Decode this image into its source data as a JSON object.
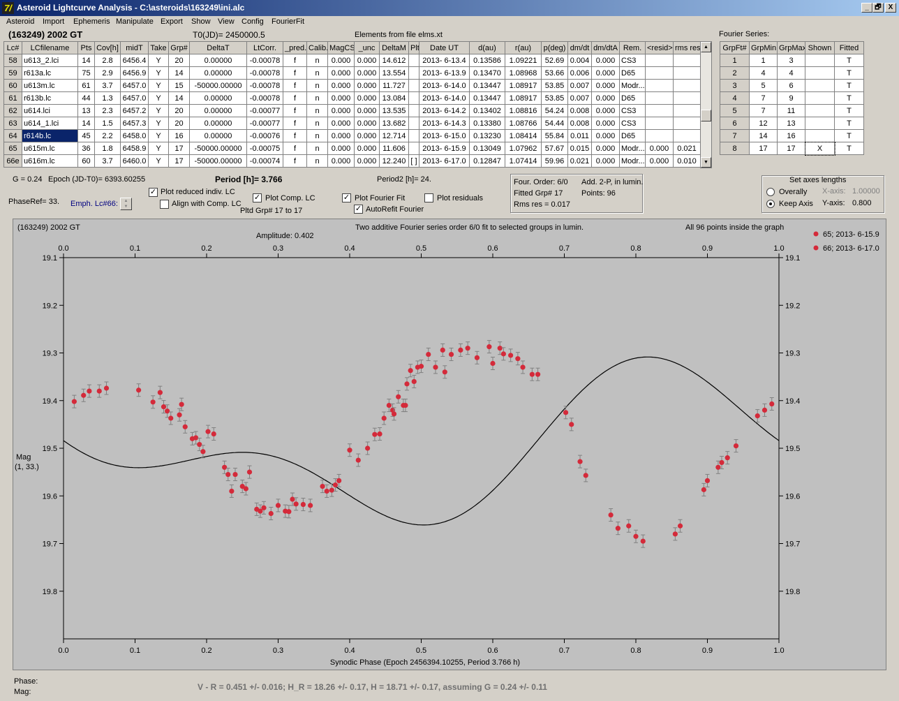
{
  "window": {
    "title": "Asteroid Lightcurve Analysis - C:\\asteroids\\163249\\ini.alc",
    "app_icon": "7/",
    "min": "_",
    "restore": "🗗",
    "close": "X"
  },
  "menu": [
    "Asteroid",
    "Import",
    "Ephemeris",
    "Manipulate",
    "Export",
    "Show",
    "View",
    "Config",
    "FourierFit"
  ],
  "header": {
    "object": "(163249) 2002 GT",
    "t0": "T0(JD)= 2450000.5",
    "elements": "Elements from file elms.xt",
    "fourier_label": "Fourier Series:"
  },
  "lc_table": {
    "columns": [
      "Lc#",
      "LCfilename",
      "Pts",
      "Cov[h]",
      "midT",
      "Take",
      "Grp#",
      "DeltaT",
      "LtCorr.",
      "_pred.",
      "Calib.",
      "MagCS",
      "_unc",
      "DeltaM",
      "Plt",
      "Date UT",
      "d(au)",
      "r(au)",
      "p(deg)",
      "dm/dt",
      "dm/dtA",
      "Rem.",
      "<resid>",
      "rms res"
    ],
    "rows": [
      [
        "58",
        "u613_2.lci",
        "14",
        "2.8",
        "6456.4",
        "Y",
        "20",
        "0.00000",
        "-0.00078",
        "f",
        "n",
        "0.000",
        "0.000",
        "14.612",
        "",
        "2013- 6-13.4",
        "0.13586",
        "1.09221",
        "52.69",
        "0.004",
        "0.000",
        "CS3",
        "",
        ""
      ],
      [
        "59",
        "r613a.lc",
        "75",
        "2.9",
        "6456.9",
        "Y",
        "14",
        "0.00000",
        "-0.00078",
        "f",
        "n",
        "0.000",
        "0.000",
        "13.554",
        "",
        "2013- 6-13.9",
        "0.13470",
        "1.08968",
        "53.66",
        "0.006",
        "0.000",
        "D65",
        "",
        ""
      ],
      [
        "60",
        "u613m.lc",
        "61",
        "3.7",
        "6457.0",
        "Y",
        "15",
        "-50000.00000",
        "-0.00078",
        "f",
        "n",
        "0.000",
        "0.000",
        "11.727",
        "",
        "2013- 6-14.0",
        "0.13447",
        "1.08917",
        "53.85",
        "0.007",
        "0.000",
        "Modr...",
        "",
        ""
      ],
      [
        "61",
        "r613b.lc",
        "44",
        "1.3",
        "6457.0",
        "Y",
        "14",
        "0.00000",
        "-0.00078",
        "f",
        "n",
        "0.000",
        "0.000",
        "13.084",
        "",
        "2013- 6-14.0",
        "0.13447",
        "1.08917",
        "53.85",
        "0.007",
        "0.000",
        "D65",
        "",
        ""
      ],
      [
        "62",
        "u614.lci",
        "13",
        "2.3",
        "6457.2",
        "Y",
        "20",
        "0.00000",
        "-0.00077",
        "f",
        "n",
        "0.000",
        "0.000",
        "13.535",
        "",
        "2013- 6-14.2",
        "0.13402",
        "1.08816",
        "54.24",
        "0.008",
        "0.000",
        "CS3",
        "",
        ""
      ],
      [
        "63",
        "u614_1.lci",
        "14",
        "1.5",
        "6457.3",
        "Y",
        "20",
        "0.00000",
        "-0.00077",
        "f",
        "n",
        "0.000",
        "0.000",
        "13.682",
        "",
        "2013- 6-14.3",
        "0.13380",
        "1.08766",
        "54.44",
        "0.008",
        "0.000",
        "CS3",
        "",
        ""
      ],
      [
        "64",
        "r614b.lc",
        "45",
        "2.2",
        "6458.0",
        "Y",
        "16",
        "0.00000",
        "-0.00076",
        "f",
        "n",
        "0.000",
        "0.000",
        "12.714",
        "",
        "2013- 6-15.0",
        "0.13230",
        "1.08414",
        "55.84",
        "0.011",
        "0.000",
        "D65",
        "",
        ""
      ],
      [
        "65",
        "u615m.lc",
        "36",
        "1.8",
        "6458.9",
        "Y",
        "17",
        "-50000.00000",
        "-0.00075",
        "f",
        "n",
        "0.000",
        "0.000",
        "11.606",
        "",
        "2013- 6-15.9",
        "0.13049",
        "1.07962",
        "57.67",
        "0.015",
        "0.000",
        "Modr...",
        "0.000",
        "0.021"
      ],
      [
        "66e",
        "u616m.lc",
        "60",
        "3.7",
        "6460.0",
        "Y",
        "17",
        "-50000.00000",
        "-0.00074",
        "f",
        "n",
        "0.000",
        "0.000",
        "12.240",
        "[ ]",
        "2013- 6-17.0",
        "0.12847",
        "1.07414",
        "59.96",
        "0.021",
        "0.000",
        "Modr...",
        "0.000",
        "0.010"
      ]
    ],
    "selected_row": 6
  },
  "fourier_table": {
    "columns": [
      "GrpFt#",
      "GrpMin",
      "GrpMax",
      "Shown",
      "Fitted"
    ],
    "rows": [
      [
        "1",
        "1",
        "3",
        "",
        "T"
      ],
      [
        "2",
        "4",
        "4",
        "",
        "T"
      ],
      [
        "3",
        "5",
        "6",
        "",
        "T"
      ],
      [
        "4",
        "7",
        "9",
        "",
        "T"
      ],
      [
        "5",
        "7",
        "11",
        "",
        "T"
      ],
      [
        "6",
        "12",
        "13",
        "",
        "T"
      ],
      [
        "7",
        "14",
        "16",
        "",
        "T"
      ],
      [
        "8",
        "17",
        "17",
        "X",
        "T"
      ]
    ]
  },
  "controls": {
    "g": "G = 0.24",
    "epoch": "Epoch (JD-T0)= 6393.60255",
    "period": "Period [h]= 3.766",
    "period2": "Period2 [h]= 24.",
    "phaseref": "PhaseRef= 33.",
    "emph": "Emph. Lc#66:",
    "plot_reduced": "Plot reduced indiv. LC",
    "align": "Align with Comp. LC",
    "plot_comp": "Plot Comp. LC",
    "pltd_grp": "Pltd Grp#  17 to   17",
    "plot_fourier": "Plot Fourier Fit",
    "autorefit": "AutoRefit Fourier",
    "plot_resid": "Plot residuals",
    "four_order": "Four. Order:  6/0",
    "add2p": "Add. 2-P, in lumin.",
    "fitted_grp": "Fitted Grp# 17",
    "points": "Points: 96",
    "rms": "Rms res     = 0.017",
    "axes_title": "Set axes lengths",
    "overally": "Overally",
    "keep_axis": "Keep Axis",
    "xaxis_lbl": "X-axis:",
    "xaxis_val": "1.00000",
    "yaxis_lbl": "Y-axis:",
    "yaxis_val": "0.800"
  },
  "plot_text": {
    "object": "(163249) 2002 GT",
    "desc": "Two additive Fourier series order 6/0 fit to selected groups in lumin.",
    "amplitude": "Amplitude: 0.402",
    "inside": "All 96 points inside the graph",
    "ylabel1": "Mag",
    "ylabel2": "(1, 33.)",
    "legend": [
      "65; 2013- 6-15.9",
      "66; 2013- 6-17.0"
    ]
  },
  "status": {
    "phase": "Phase:",
    "mag": "Mag:",
    "result": "V - R = 0.451 +/- 0.016; H_R = 18.26 +/- 0.17, H = 18.71 +/- 0.17, assuming G = 0.24 +/- 0.11"
  },
  "colors": {
    "point": "#d42a3a",
    "plot_bg": "#c0c0c0",
    "curve": "#000000"
  },
  "chart_data": {
    "type": "scatter",
    "title": "Two additive Fourier series order 6/0 fit to selected groups in lumin.",
    "xlabel": "Synodic Phase (Epoch 2456394.10255, Period 3.766 h)",
    "ylabel": "Mag",
    "xlim": [
      0,
      1
    ],
    "ylim": [
      19.1,
      19.9
    ],
    "y_inverted": true,
    "x_ticks": [
      "0.0",
      "0.1",
      "0.2",
      "0.3",
      "0.4",
      "0.5",
      "0.6",
      "0.7",
      "0.8",
      "0.9",
      "1.0"
    ],
    "y_ticks": [
      "19.1",
      "19.2",
      "19.3",
      "19.4",
      "19.5",
      "19.6",
      "19.7",
      "19.8"
    ],
    "legend_position": "top-right, outside plot",
    "fit_curve": {
      "mean": 19.5,
      "a1": 0.12,
      "phi1": 2.4,
      "a2": 0.085,
      "phi2": 0.55
    },
    "series": [
      {
        "name": "65; 2013- 6-15.9",
        "points": [
          [
            0.015,
            19.402
          ],
          [
            0.028,
            19.389
          ],
          [
            0.036,
            19.38
          ],
          [
            0.05,
            19.38
          ],
          [
            0.06,
            19.374
          ],
          [
            0.105,
            19.378
          ],
          [
            0.125,
            19.403
          ],
          [
            0.135,
            19.383
          ],
          [
            0.14,
            19.413
          ],
          [
            0.145,
            19.422
          ],
          [
            0.15,
            19.437
          ],
          [
            0.162,
            19.43
          ],
          [
            0.165,
            19.408
          ],
          [
            0.17,
            19.455
          ],
          [
            0.18,
            19.48
          ],
          [
            0.185,
            19.478
          ],
          [
            0.19,
            19.492
          ],
          [
            0.195,
            19.507
          ],
          [
            0.202,
            19.465
          ],
          [
            0.21,
            19.47
          ],
          [
            0.225,
            19.54
          ],
          [
            0.23,
            19.555
          ],
          [
            0.235,
            19.59
          ],
          [
            0.24,
            19.555
          ],
          [
            0.25,
            19.58
          ],
          [
            0.255,
            19.585
          ],
          [
            0.26,
            19.55
          ],
          [
            0.27,
            19.628
          ],
          [
            0.275,
            19.632
          ],
          [
            0.28,
            19.625
          ],
          [
            0.29,
            19.637
          ],
          [
            0.3,
            19.62
          ],
          [
            0.31,
            19.632
          ],
          [
            0.315,
            19.633
          ],
          [
            0.32,
            19.607
          ],
          [
            0.325,
            19.617
          ],
          [
            0.335,
            19.618
          ],
          [
            0.345,
            19.62
          ],
          [
            0.362,
            19.58
          ],
          [
            0.368,
            19.59
          ],
          [
            0.375,
            19.588
          ],
          [
            0.38,
            19.577
          ],
          [
            0.385,
            19.568
          ],
          [
            0.4,
            19.504
          ],
          [
            0.412,
            19.525
          ],
          [
            0.425,
            19.5
          ],
          [
            0.435,
            19.471
          ],
          [
            0.442,
            19.47
          ],
          [
            0.448,
            19.437
          ],
          [
            0.455,
            19.41
          ],
          [
            0.46,
            19.42
          ],
          [
            0.462,
            19.428
          ],
          [
            0.468,
            19.392
          ]
        ]
      },
      {
        "name": "66; 2013- 6-17.0",
        "points": [
          [
            0.475,
            19.41
          ],
          [
            0.478,
            19.41
          ],
          [
            0.48,
            19.365
          ],
          [
            0.485,
            19.337
          ],
          [
            0.49,
            19.36
          ],
          [
            0.495,
            19.33
          ],
          [
            0.5,
            19.328
          ],
          [
            0.51,
            19.303
          ],
          [
            0.52,
            19.33
          ],
          [
            0.53,
            19.294
          ],
          [
            0.533,
            19.34
          ],
          [
            0.542,
            19.303
          ],
          [
            0.555,
            19.294
          ],
          [
            0.565,
            19.29
          ],
          [
            0.578,
            19.31
          ],
          [
            0.595,
            19.287
          ],
          [
            0.6,
            19.322
          ],
          [
            0.61,
            19.29
          ],
          [
            0.615,
            19.302
          ],
          [
            0.625,
            19.305
          ],
          [
            0.635,
            19.312
          ],
          [
            0.642,
            19.33
          ],
          [
            0.655,
            19.345
          ],
          [
            0.663,
            19.345
          ],
          [
            0.702,
            19.425
          ],
          [
            0.71,
            19.45
          ],
          [
            0.722,
            19.528
          ],
          [
            0.73,
            19.557
          ],
          [
            0.765,
            19.64
          ],
          [
            0.775,
            19.668
          ],
          [
            0.79,
            19.663
          ],
          [
            0.8,
            19.685
          ],
          [
            0.81,
            19.695
          ],
          [
            0.855,
            19.68
          ],
          [
            0.862,
            19.663
          ],
          [
            0.895,
            19.587
          ],
          [
            0.9,
            19.568
          ],
          [
            0.915,
            19.54
          ],
          [
            0.92,
            19.53
          ],
          [
            0.928,
            19.52
          ],
          [
            0.94,
            19.495
          ],
          [
            0.97,
            19.432
          ],
          [
            0.98,
            19.42
          ],
          [
            0.99,
            19.407
          ]
        ]
      }
    ]
  }
}
